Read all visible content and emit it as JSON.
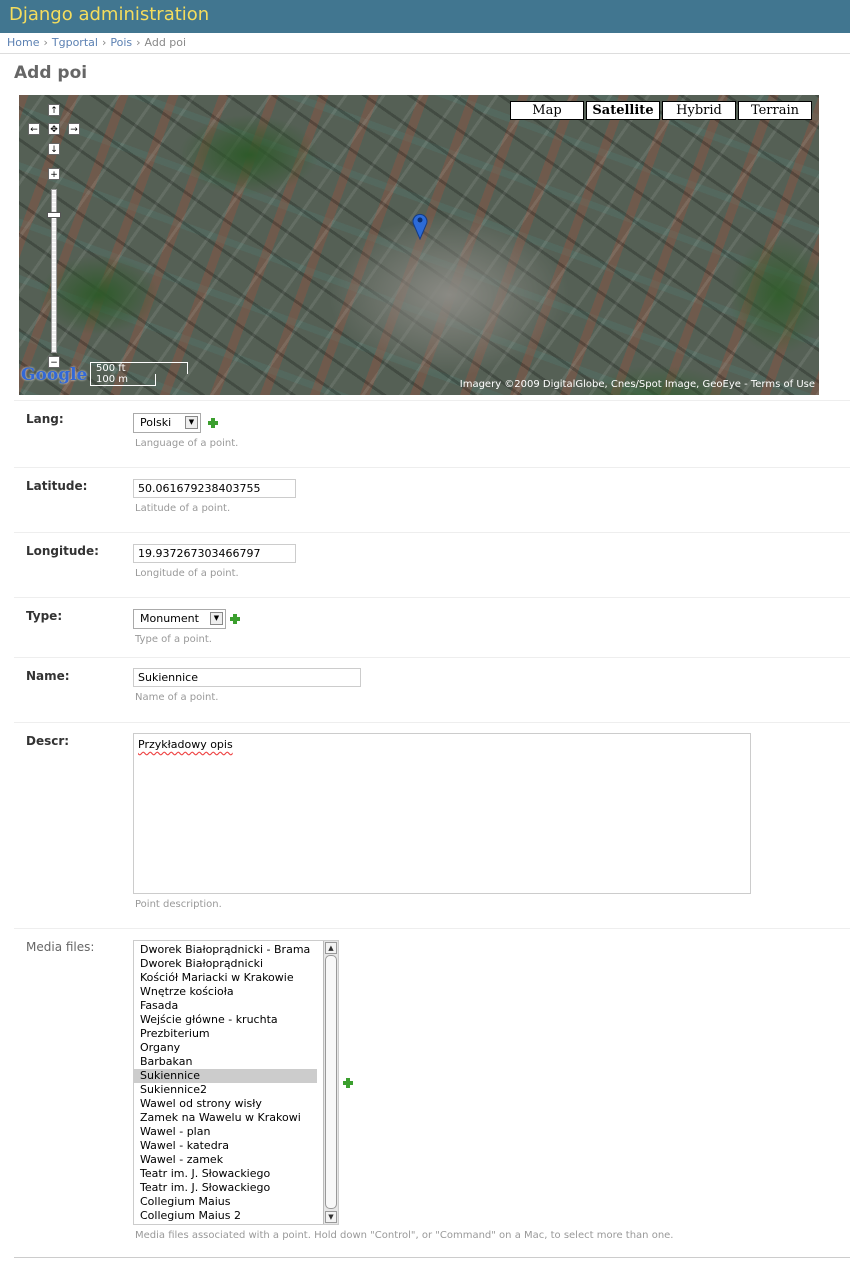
{
  "header": {
    "title": "Django administration"
  },
  "breadcrumbs": {
    "home": "Home",
    "app": "Tgportal",
    "model": "Pois",
    "current": "Add poi"
  },
  "page": {
    "title": "Add poi"
  },
  "map": {
    "map_types": [
      "Map",
      "Satellite",
      "Hybrid",
      "Terrain"
    ],
    "active_type": "Satellite",
    "scale_ft": "500 ft",
    "scale_m": "100 m",
    "logo": "Google",
    "attribution": "Imagery ©2009 DigitalGlobe, Cnes/Spot Image, GeoEye - Terms of Use",
    "controls": {
      "up": "↑",
      "left": "←",
      "center": "✥",
      "right": "→",
      "down": "↓",
      "zoom_in": "+",
      "zoom_out": "−"
    }
  },
  "form": {
    "lang": {
      "label": "Lang:",
      "value": "Polski",
      "help": "Language of a point."
    },
    "latitude": {
      "label": "Latitude:",
      "value": "50.061679238403755",
      "help": "Latitude of a point."
    },
    "longitude": {
      "label": "Longitude:",
      "value": "19.937267303466797",
      "help": "Longitude of a point."
    },
    "type": {
      "label": "Type:",
      "value": "Monument",
      "help": "Type of a point."
    },
    "name": {
      "label": "Name:",
      "value": "Sukiennice",
      "help": "Name of a point."
    },
    "descr": {
      "label": "Descr:",
      "value": "Przykładowy opis",
      "help": "Point description."
    },
    "media": {
      "label": "Media files:",
      "options": [
        "Dworek Białoprądnicki - Brama",
        "Dworek Białoprądnicki",
        "Kościół Mariacki w Krakowie",
        "Wnętrze kościoła",
        "Fasada",
        "Wejście główne - kruchta",
        "Prezbiterium",
        "Organy",
        "Barbakan",
        "Sukiennice",
        "Sukiennice2",
        "Wawel od strony wisły",
        "Zamek na Wawelu w Krakowi",
        "Wawel - plan",
        "Wawel - katedra",
        "Wawel - zamek",
        "Teatr im. J. Słowackiego",
        "Teatr im. J. Słowackiego",
        "Collegium Maius",
        "Collegium Maius 2"
      ],
      "selected": "Sukiennice",
      "help": "Media files associated with a point. Hold down \"Control\", or \"Command\" on a Mac, to select more than one."
    }
  }
}
